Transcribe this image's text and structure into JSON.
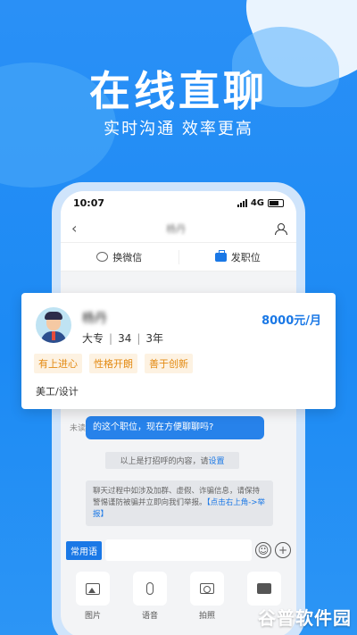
{
  "promo": {
    "headline": "在线直聊",
    "subline": "实时沟通  效率更高"
  },
  "statusbar": {
    "time": "10:07",
    "network": "4G"
  },
  "nav": {
    "back_icon": "chevron-left-icon",
    "title": "杨丹",
    "profile_icon": "user-icon"
  },
  "actions": {
    "swap_wechat": "换微信",
    "post_job": "发职位"
  },
  "candidate": {
    "name": "杨丹",
    "education": "大专",
    "age": "34",
    "experience": "3年",
    "salary": "8000元/月",
    "tags": [
      "有上进心",
      "性格开朗",
      "善于创新"
    ],
    "role": "美工/设计"
  },
  "chat": {
    "unread_label": "未读",
    "bubble_text": "的这个职位，现在方便聊聊吗?",
    "greeting_notice": "以上是打招呼的内容，请",
    "greeting_link": "设置",
    "safety_notice": "聊天过程中如涉及加群、虚假、诈骗信息，请保持警惕谨防被骗并立即向我们举报。",
    "safety_link": "【点击右上角->举报】"
  },
  "input": {
    "quick_phrases": "常用语",
    "emoji_icon": "emoji-icon",
    "plus_icon": "plus-icon"
  },
  "tools": [
    {
      "label": "图片",
      "icon": "image-icon"
    },
    {
      "label": "语音",
      "icon": "mic-icon"
    },
    {
      "label": "拍照",
      "icon": "camera-icon"
    },
    {
      "label": "",
      "icon": "video-icon"
    }
  ],
  "watermark": "谷普软件园",
  "colors": {
    "background": "#1f8ef5",
    "accent": "#1a78e6",
    "tag_text": "#e38a12",
    "tag_bg": "#fdf2e2"
  }
}
